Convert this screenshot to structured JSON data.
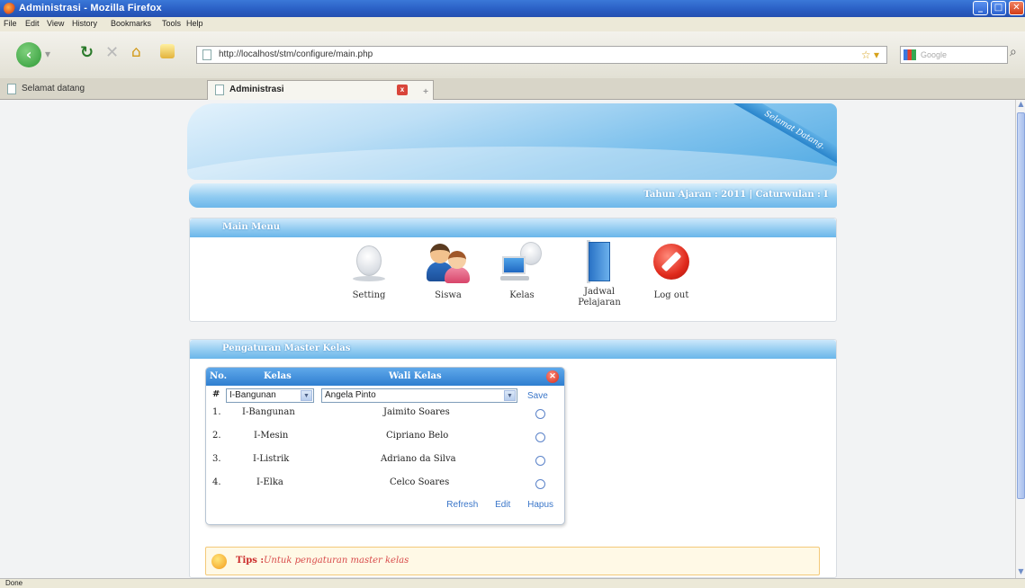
{
  "browser": {
    "window_title": "Administrasi - Mozilla Firefox",
    "menu": [
      "File",
      "Edit",
      "View",
      "History",
      "Bookmarks",
      "Tools",
      "Help"
    ],
    "url": "http://localhost/stm/configure/main.php",
    "search_placeholder": "Google",
    "tabs": [
      {
        "label": "Selamat datang",
        "active": false
      },
      {
        "label": "Administrasi",
        "active": true
      }
    ],
    "status": "Done"
  },
  "page": {
    "banner_ribbon": "Selamat Datang.",
    "info": "Tahun Ajaran : 2011 | Caturwulan : I",
    "main_menu": {
      "title": "Main Menu",
      "items": [
        {
          "label": "Setting",
          "icon": "setting-icon"
        },
        {
          "label": "Siswa",
          "icon": "students-icon"
        },
        {
          "label": "Kelas",
          "icon": "class-icon"
        },
        {
          "label": "Jadwal Pelajaran",
          "icon": "schedule-icon"
        },
        {
          "label": "Log out",
          "icon": "logout-icon"
        }
      ]
    },
    "master": {
      "title": "Pengaturan Master Kelas",
      "columns": {
        "no": "No.",
        "kelas": "Kelas",
        "wali": "Wali Kelas"
      },
      "form": {
        "hash": "#",
        "kelas_value": "I-Bangunan",
        "wali_value": "Angela Pinto",
        "save": "Save"
      },
      "rows": [
        {
          "no": "1.",
          "kelas": "I-Bangunan",
          "wali": "Jaimito Soares"
        },
        {
          "no": "2.",
          "kelas": "I-Mesin",
          "wali": "Cipriano Belo"
        },
        {
          "no": "3.",
          "kelas": "I-Listrik",
          "wali": "Adriano da Silva"
        },
        {
          "no": "4.",
          "kelas": "I-Elka",
          "wali": "Celco Soares"
        }
      ],
      "actions": {
        "refresh": "Refresh",
        "edit": "Edit",
        "hapus": "Hapus"
      }
    },
    "tips": {
      "label": "Tips :",
      "text": "Untuk pengaturan master kelas"
    }
  }
}
